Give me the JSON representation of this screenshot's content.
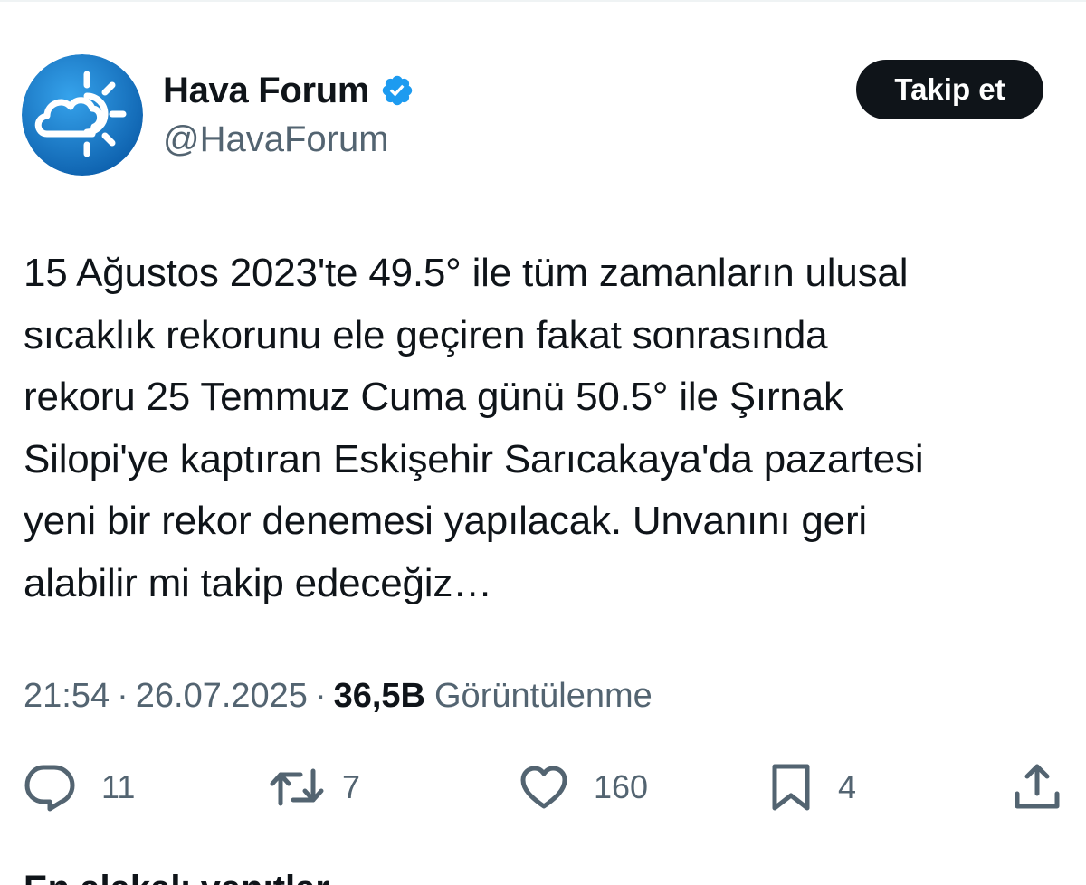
{
  "account": {
    "display_name": "Hava Forum",
    "handle": "@HavaForum",
    "verified_icon": "verified-badge-icon",
    "avatar_icon": "cloud-sun-icon",
    "avatar_colors": [
      "#1f8ad9",
      "#0b5fae"
    ]
  },
  "follow_button": {
    "label": "Takip et"
  },
  "tweet": {
    "lines": [
      "15 Ağustos 2023'te 49.5° ile tüm zamanların ulusal",
      "sıcaklık rekorunu ele geçiren fakat sonrasında",
      "rekoru 25 Temmuz Cuma günü 50.5° ile Şırnak",
      "Silopi'ye kaptıran Eskişehir Sarıcakaya'da pazartesi",
      "yeni bir rekor denemesi yapılacak. Unvanını geri",
      "alabilir mi takip edeceğiz…"
    ]
  },
  "meta": {
    "time": "21:54",
    "separator": "·",
    "date": "26.07.2025",
    "views_count": "36,5B",
    "views_label": "Görüntülenme"
  },
  "actions": {
    "reply": {
      "icon": "reply-icon",
      "count": "11"
    },
    "repost": {
      "icon": "repost-icon",
      "count": "7"
    },
    "like": {
      "icon": "like-icon",
      "count": "160"
    },
    "bookmark": {
      "icon": "bookmark-icon",
      "count": "4"
    },
    "share": {
      "icon": "share-icon"
    }
  },
  "bottom_peek": {
    "text": "En alakalı yanıtlar"
  },
  "colors": {
    "text_primary": "#0f1419",
    "text_secondary": "#536471",
    "verified_blue": "#1d9bf0",
    "button_bg": "#0f1419"
  }
}
